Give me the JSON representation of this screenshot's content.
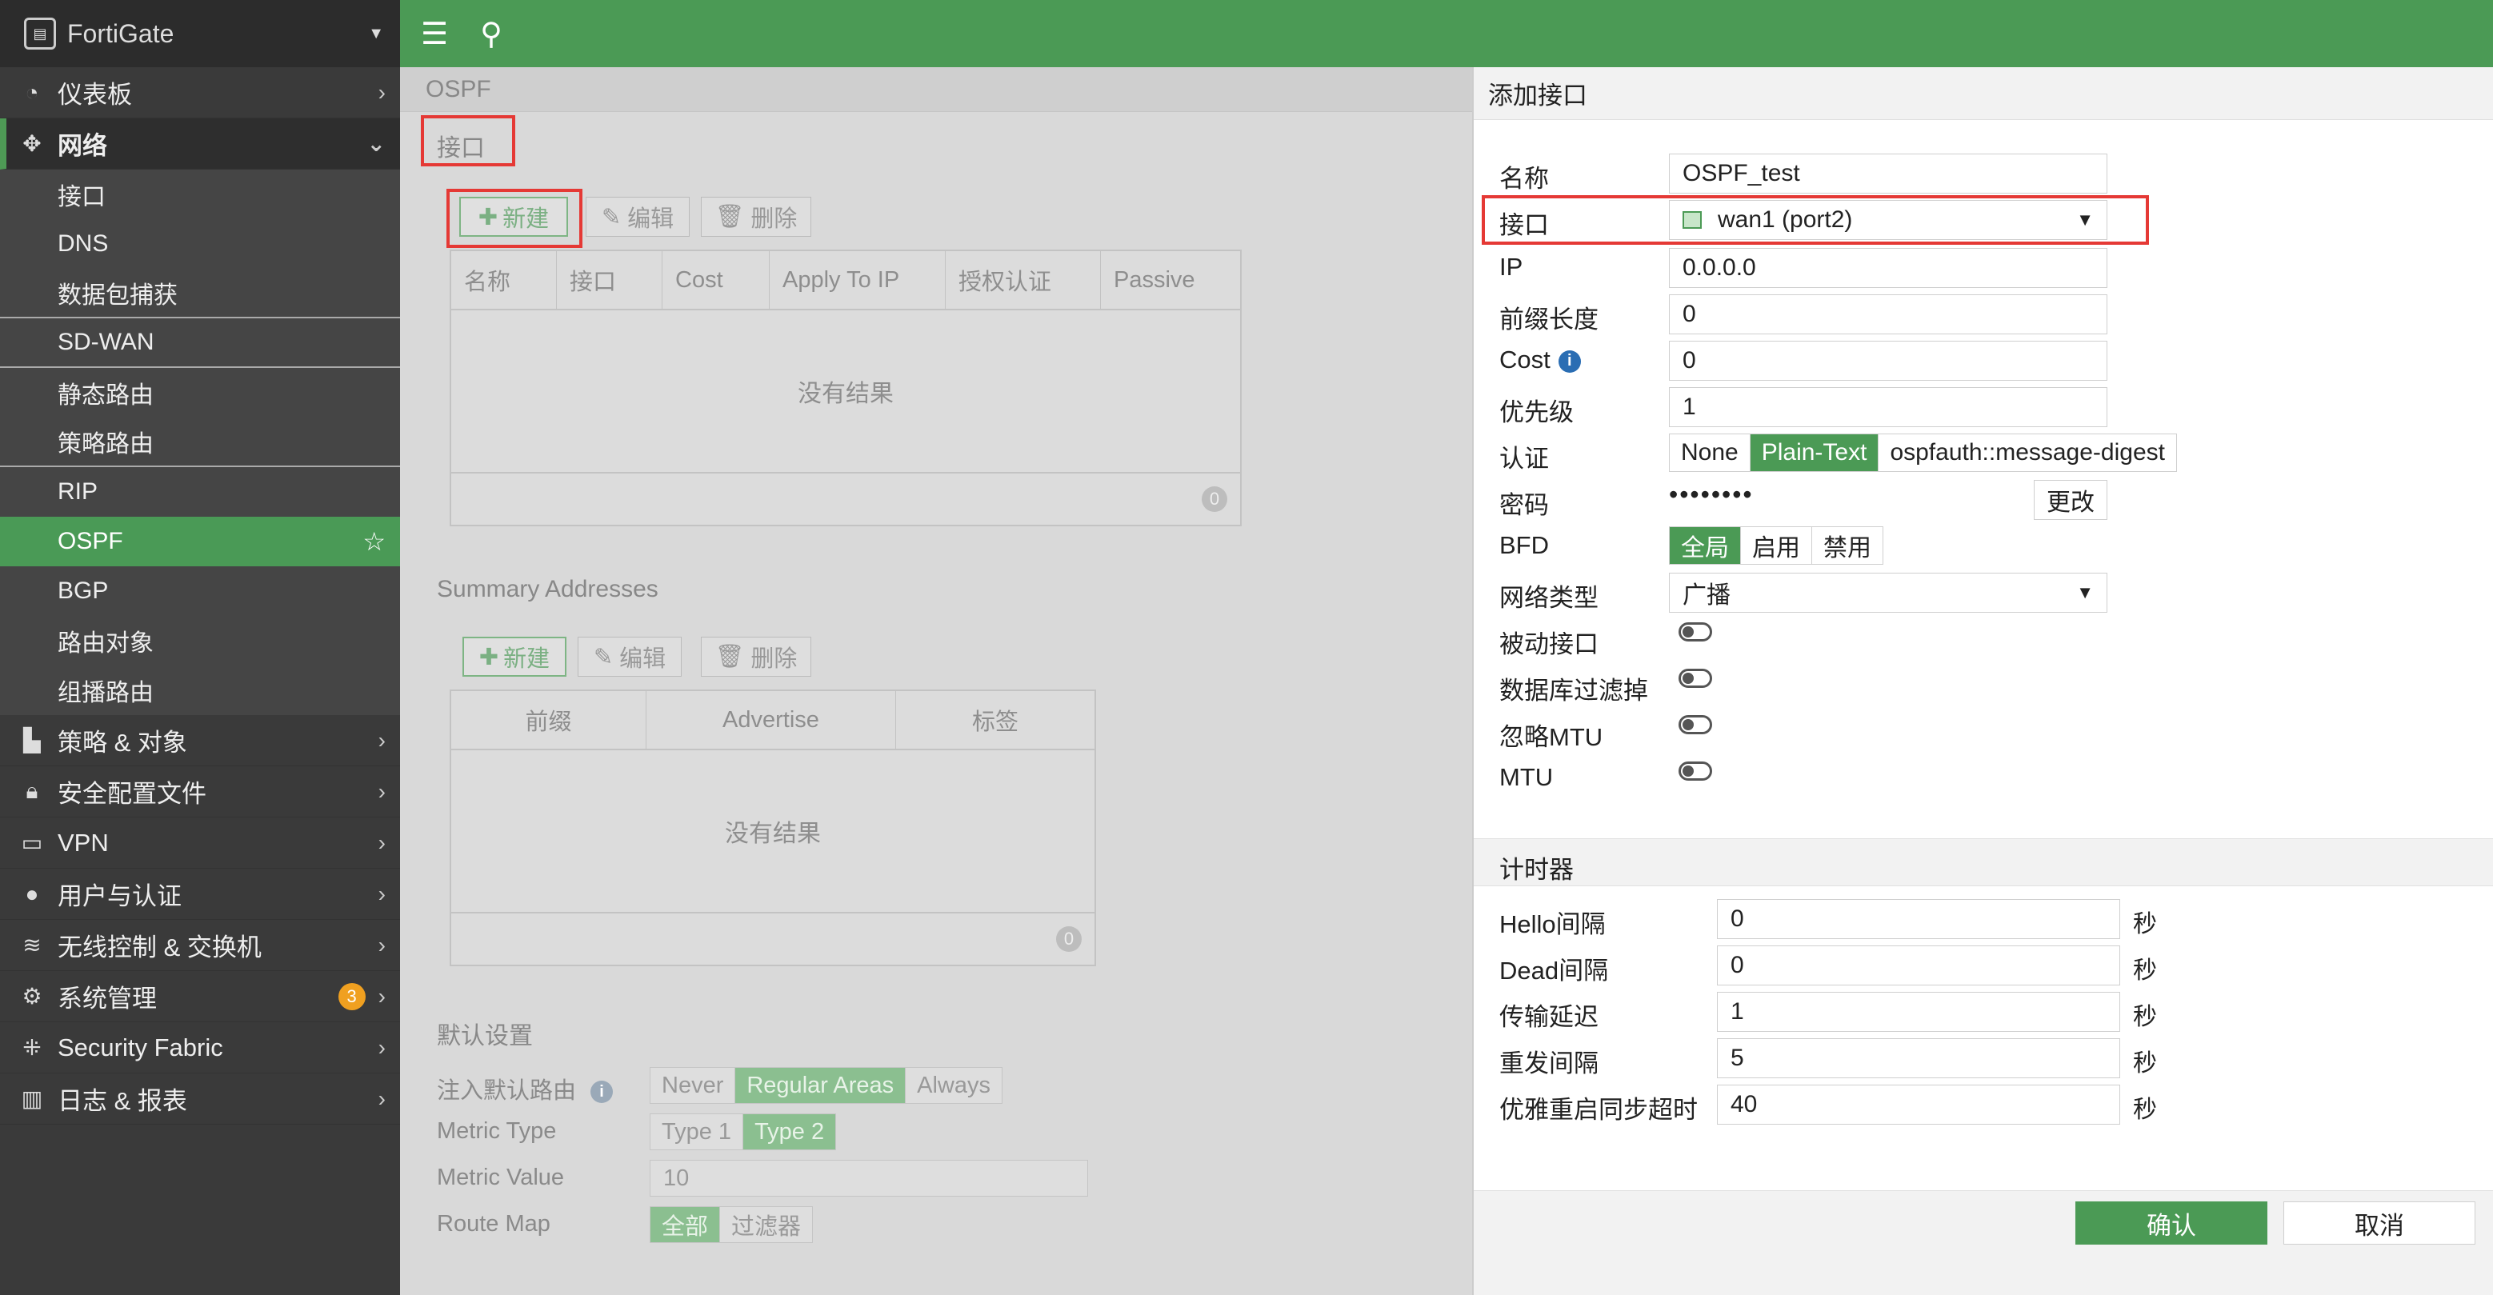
{
  "brand": {
    "name": "FortiGate"
  },
  "sidebar": {
    "top_items": [
      {
        "label": "仪表板",
        "icon": "dashboard-icon"
      },
      {
        "label": "网络",
        "icon": "network-icon"
      }
    ],
    "network_sub": [
      "接口",
      "DNS",
      "数据包捕获",
      "SD-WAN",
      "静态路由",
      "策略路由",
      "RIP",
      "OSPF",
      "BGP",
      "路由对象",
      "组播路由"
    ],
    "bottom_items": [
      {
        "label": "策略 & 对象",
        "icon": "policy-icon"
      },
      {
        "label": "安全配置文件",
        "icon": "lock-icon"
      },
      {
        "label": "VPN",
        "icon": "vpn-icon"
      },
      {
        "label": "用户与认证",
        "icon": "user-icon"
      },
      {
        "label": "无线控制 & 交换机",
        "icon": "wifi-icon"
      },
      {
        "label": "系统管理",
        "icon": "gear-icon",
        "badge": "3"
      },
      {
        "label": "Security Fabric",
        "icon": "fabric-icon"
      },
      {
        "label": "日志 & 报表",
        "icon": "chart-icon"
      }
    ]
  },
  "main": {
    "title": "OSPF",
    "interfaces": {
      "title": "接口",
      "new": "新建",
      "edit": "编辑",
      "delete": "删除",
      "columns": [
        "名称",
        "接口",
        "Cost",
        "Apply To IP",
        "授权认证",
        "Passive"
      ],
      "empty": "没有结果",
      "count": "0"
    },
    "summary": {
      "title": "Summary Addresses",
      "new": "新建",
      "edit": "编辑",
      "delete": "删除",
      "columns": [
        "前缀",
        "Advertise",
        "标签"
      ],
      "empty": "没有结果",
      "count": "0"
    },
    "defaults": {
      "title": "默认设置",
      "inject_label": "注入默认路由",
      "inject_opts": [
        "Never",
        "Regular Areas",
        "Always"
      ],
      "metric_type_label": "Metric Type",
      "metric_type_opts": [
        "Type 1",
        "Type 2"
      ],
      "metric_value_label": "Metric Value",
      "metric_value": "10",
      "route_map_label": "Route Map",
      "route_map_opts": [
        "全部",
        "过滤器"
      ]
    }
  },
  "panel": {
    "title": "添加接口",
    "name_label": "名称",
    "name_value": "OSPF_test",
    "iface_label": "接口",
    "iface_value": "wan1 (port2)",
    "ip_label": "IP",
    "ip_value": "0.0.0.0",
    "prefix_label": "前缀长度",
    "prefix_value": "0",
    "cost_label": "Cost",
    "cost_value": "0",
    "priority_label": "优先级",
    "priority_value": "1",
    "auth_label": "认证",
    "auth_opts": [
      "None",
      "Plain-Text",
      "ospfauth::message-digest"
    ],
    "password_label": "密码",
    "password_value": "••••••••",
    "change": "更改",
    "bfd_label": "BFD",
    "bfd_opts": [
      "全局",
      "启用",
      "禁用"
    ],
    "nettype_label": "网络类型",
    "nettype_value": "广播",
    "passive_label": "被动接口",
    "dbfilter_label": "数据库过滤掉",
    "ignoremtu_label": "忽略MTU",
    "mtu_label": "MTU",
    "timers_title": "计时器",
    "timers": [
      {
        "label": "Hello间隔",
        "value": "0",
        "unit": "秒"
      },
      {
        "label": "Dead间隔",
        "value": "0",
        "unit": "秒"
      },
      {
        "label": "传输延迟",
        "value": "1",
        "unit": "秒"
      },
      {
        "label": "重发间隔",
        "value": "5",
        "unit": "秒"
      },
      {
        "label": "优雅重启同步超时",
        "value": "40",
        "unit": "秒"
      }
    ],
    "ok": "确认",
    "cancel": "取消"
  }
}
